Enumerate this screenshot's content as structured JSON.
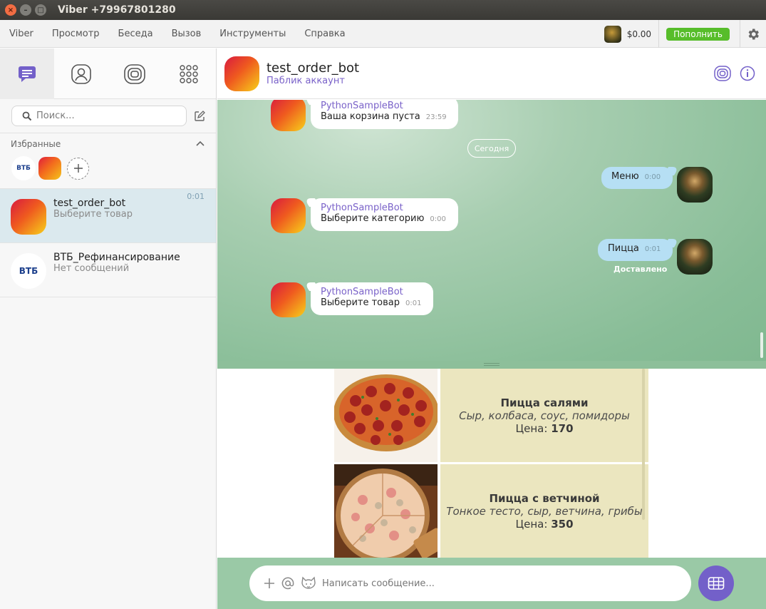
{
  "window": {
    "title": "Viber +79967801280"
  },
  "menu": {
    "items": [
      "Viber",
      "Просмотр",
      "Беседа",
      "Вызов",
      "Инструменты",
      "Справка"
    ],
    "balance": "$0.00",
    "topup_label": "Пополнить"
  },
  "sidebar": {
    "search_placeholder": "Поиск...",
    "favorites_label": "Избранные",
    "fav_vtb_text": "ВТБ",
    "chats": [
      {
        "name": "test_order_bot",
        "subtitle": "Выберите товар",
        "time": "0:01"
      },
      {
        "name": "ВТБ_Рефинансирование",
        "subtitle": "Нет сообщений",
        "time": ""
      }
    ],
    "vtb_avatar_text": "ВТБ"
  },
  "chat": {
    "name": "test_order_bot",
    "subtitle": "Паблик аккаунт",
    "date_separator": "Сегодня",
    "messages": [
      {
        "sender": "PythonSampleBot",
        "text": "Ваша корзина пуста",
        "time": "23:59"
      },
      {
        "text": "Меню",
        "time": "0:00"
      },
      {
        "sender": "PythonSampleBot",
        "text": "Выберите категорию",
        "time": "0:00"
      },
      {
        "text": "Пицца",
        "time": "0:01",
        "status": "Доставлено"
      },
      {
        "sender": "PythonSampleBot",
        "text": "Выберите товар",
        "time": "0:01"
      }
    ]
  },
  "keyboard": {
    "items": [
      {
        "title": "Пицца салями",
        "desc": "Сыр, колбаса, соус, помидоры",
        "price_label": "Цена:",
        "price": "170"
      },
      {
        "title": "Пицца с ветчиной",
        "desc": "Тонкое тесто, сыр, ветчина, грибы",
        "price_label": "Цена:",
        "price": "350"
      }
    ]
  },
  "composer": {
    "placeholder": "Написать сообщение..."
  },
  "colors": {
    "accent": "#7360c9",
    "green": "#57bd2a",
    "outgoing": "#b6dff4"
  },
  "icons": [
    "chats-icon",
    "contacts-icon",
    "public-accounts-icon",
    "dialpad-icon",
    "search-icon",
    "compose-icon",
    "gear-icon",
    "info-icon",
    "plus-icon",
    "mention-icon",
    "sticker-icon",
    "keyboard-icon"
  ]
}
